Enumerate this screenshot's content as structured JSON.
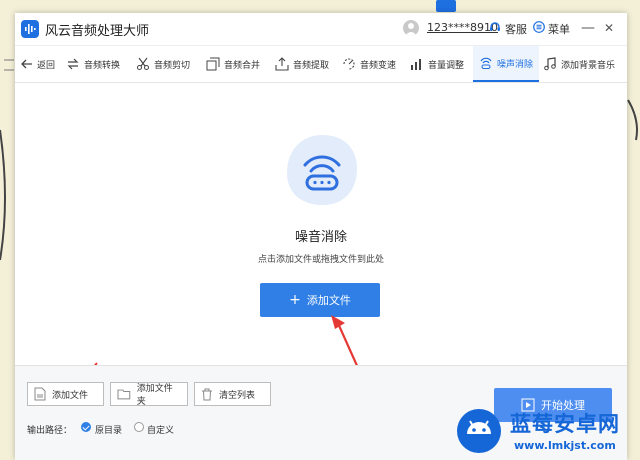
{
  "app": {
    "title": "风云音频处理大师",
    "user_id": "123****8910",
    "service_label": "客服",
    "menu_label": "菜单",
    "minimize": "—",
    "close": "✕"
  },
  "toolbar": {
    "items": [
      {
        "label": "返回",
        "icon": "back-arrow-icon"
      },
      {
        "label": "音频转换",
        "icon": "convert-icon"
      },
      {
        "label": "音频剪切",
        "icon": "scissors-icon"
      },
      {
        "label": "音频合并",
        "icon": "merge-icon"
      },
      {
        "label": "音频提取",
        "icon": "extract-icon"
      },
      {
        "label": "音频变速",
        "icon": "speed-icon"
      },
      {
        "label": "音量调整",
        "icon": "volume-bars-icon"
      },
      {
        "label": "噪声消除",
        "icon": "noise-icon",
        "active": true
      },
      {
        "label": "添加背景音乐",
        "icon": "music-note-icon"
      }
    ]
  },
  "main": {
    "title": "噪音消除",
    "hint": "点击添加文件或拖拽文件到此处",
    "add_file_label": "添加文件"
  },
  "footer": {
    "add_file": "添加文件",
    "add_folder": "添加文件夹",
    "clear_list": "清空列表",
    "output_label": "输出路径：",
    "option_original": "原目录",
    "option_custom": "自定义",
    "start_label": "开始处理"
  },
  "watermark": {
    "title": "蓝莓安卓网",
    "url": "www.lmkjst.com"
  },
  "colors": {
    "accent": "#2f7fe6",
    "active_tab": "#1e6fe0",
    "annotation_arrow": "#e53935",
    "watermark": "#1566d6"
  }
}
